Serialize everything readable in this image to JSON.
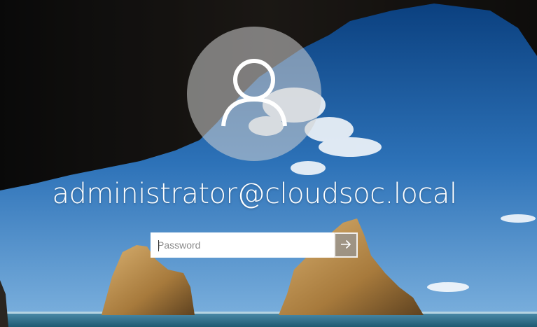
{
  "user": {
    "name": "administrator@cloudsoc.local",
    "avatar_icon": "user-silhouette-icon"
  },
  "password": {
    "placeholder": "Password",
    "value": ""
  },
  "submit": {
    "icon": "arrow-right-icon"
  },
  "colors": {
    "sky_top": "#0a4a8f",
    "sky_bottom": "#5fa0d8",
    "cave": "#141414",
    "sea": "#2e6f8a",
    "rock": "#b38a4a"
  }
}
